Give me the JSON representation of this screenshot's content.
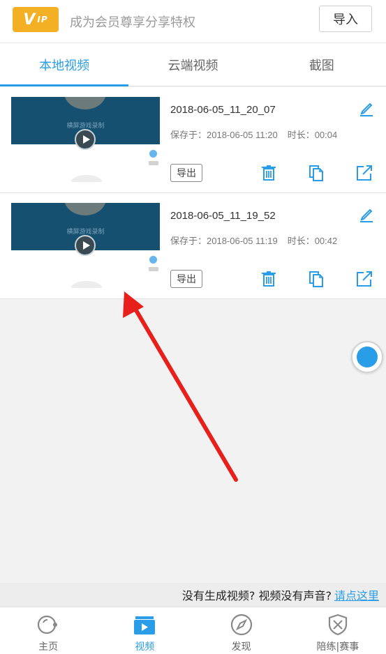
{
  "header": {
    "vip_badge": "V",
    "vip_badge_small": "IP",
    "vip_text": "成为会员尊享分享特权",
    "import_label": "导入"
  },
  "tabs": [
    {
      "label": "本地视频",
      "active": true
    },
    {
      "label": "云端视频",
      "active": false
    },
    {
      "label": "截图",
      "active": false
    }
  ],
  "videos": [
    {
      "name": "2018-06-05_11_20_07",
      "saved_label": "保存于：2018-06-05 11:20",
      "duration_label": "时长：00:04",
      "thumb_caption": "横屏游戏录制",
      "export_label": "导出"
    },
    {
      "name": "2018-06-05_11_19_52",
      "saved_label": "保存于：2018-06-05 11:19",
      "duration_label": "时长：00:42",
      "thumb_caption": "横屏游戏录制",
      "export_label": "导出"
    }
  ],
  "help": {
    "question": "没有生成视频? 视频没有声音?",
    "link": "请点这里"
  },
  "bottom_nav": [
    {
      "label": "主页",
      "icon": "home-dial-icon",
      "active": false
    },
    {
      "label": "视频",
      "icon": "video-play-icon",
      "active": true
    },
    {
      "label": "发现",
      "icon": "compass-icon",
      "active": false
    },
    {
      "label": "陪练|赛事",
      "icon": "shield-swords-icon",
      "active": false
    }
  ],
  "colors": {
    "accent": "#2a9de8",
    "vip": "#f4b024",
    "annotation_arrow": "#e8201c"
  }
}
